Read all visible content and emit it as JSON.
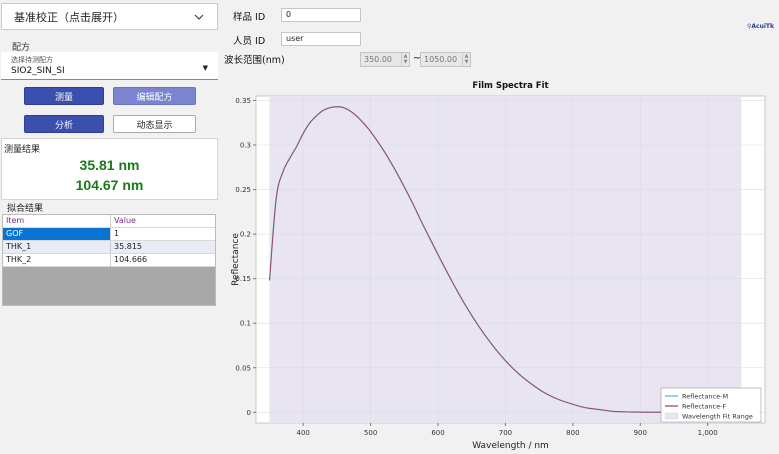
{
  "calibration": {
    "label": "基准校正（点击展开）"
  },
  "recipe": {
    "section_title": "配方",
    "select_label": "选择待测配方",
    "selected": "SIO2_SIN_SI"
  },
  "buttons": {
    "measure": "测量",
    "edit_recipe": "编辑配方",
    "analyze": "分析",
    "dynamic_display": "动态显示"
  },
  "measurement": {
    "title": "测量结果",
    "value1": "35.81 nm",
    "value2": "104.67 nm"
  },
  "fit": {
    "title": "拟合结果",
    "headers": [
      "Item",
      "Value"
    ],
    "rows": [
      [
        "GOF",
        "1"
      ],
      [
        "THK_1",
        "35.815"
      ],
      [
        "THK_2",
        "104.666"
      ]
    ]
  },
  "form": {
    "sample_id_label": "样品 ID",
    "sample_id_value": "0",
    "operator_id_label": "人员 ID",
    "operator_id_value": "user",
    "wavelength_label": "波长范围(nm)",
    "range_start": "350.00",
    "range_sep": "~",
    "range_end": "1050.00"
  },
  "logo": "AcuiTk",
  "chart_data": {
    "type": "line",
    "title": "Film Spectra Fit",
    "xlabel": "Wavelength / nm",
    "ylabel": "Reflectance",
    "xlim": [
      330,
      1085
    ],
    "ylim": [
      -0.012,
      0.355
    ],
    "xticks": [
      400,
      500,
      600,
      700,
      800,
      900,
      1000
    ],
    "xtick_labels": [
      "400",
      "500",
      "600",
      "700",
      "800",
      "900",
      "1,000"
    ],
    "yticks": [
      0,
      0.05,
      0.1,
      0.15,
      0.2,
      0.25,
      0.3,
      0.35
    ],
    "ytick_labels": [
      "0",
      "0.05",
      "0.1",
      "0.15",
      "0.2",
      "0.25",
      "0.3",
      "0.35"
    ],
    "fit_range": [
      350,
      1050
    ],
    "grid": true,
    "legend_position": "bottom-right",
    "legend": [
      "Reflectance-M",
      "Reflectance-F",
      "Wavelength Fit Range"
    ],
    "colors": {
      "M": "#5fb9d8",
      "F": "#a04a66",
      "range": "#e9e4f1"
    },
    "x": [
      350,
      360,
      370,
      380,
      390,
      400,
      410,
      420,
      430,
      440,
      450,
      460,
      470,
      480,
      490,
      500,
      520,
      540,
      560,
      580,
      600,
      620,
      640,
      660,
      680,
      700,
      720,
      740,
      760,
      780,
      800,
      820,
      840,
      860,
      880,
      900,
      920,
      940,
      960,
      980,
      1000,
      1020,
      1050
    ],
    "y": [
      0.148,
      0.24,
      0.27,
      0.285,
      0.298,
      0.313,
      0.325,
      0.333,
      0.339,
      0.342,
      0.343,
      0.342,
      0.338,
      0.332,
      0.324,
      0.315,
      0.293,
      0.267,
      0.238,
      0.207,
      0.177,
      0.148,
      0.121,
      0.097,
      0.076,
      0.058,
      0.043,
      0.031,
      0.021,
      0.014,
      0.009,
      0.005,
      0.003,
      0.001,
      0.0005,
      0.0002,
      0.0001,
      0.0002,
      0.0005,
      0.0008,
      0.0012,
      0.0015,
      0.0018
    ]
  }
}
